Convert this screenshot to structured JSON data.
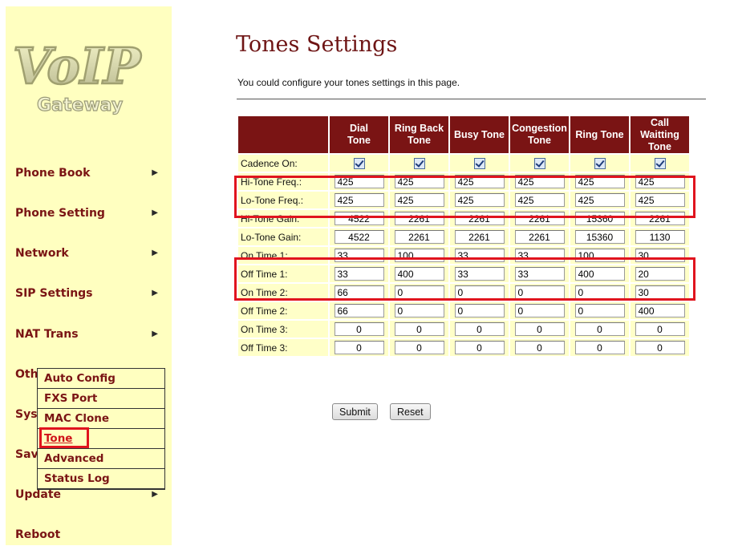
{
  "logo": {
    "text_main": "VoIP",
    "text_sub": "Gateway"
  },
  "nav": [
    {
      "label": "Phone Book",
      "arrow": "▶"
    },
    {
      "label": "Phone Setting",
      "arrow": "▶"
    },
    {
      "label": "Network",
      "arrow": "▶"
    },
    {
      "label": "SIP Settings",
      "arrow": "▶"
    },
    {
      "label": "NAT Trans",
      "arrow": "▶"
    },
    {
      "label": "Oth",
      "arrow": ""
    },
    {
      "label": "Sys",
      "arrow": ""
    },
    {
      "label": "Sav",
      "arrow": ""
    },
    {
      "label": "Update",
      "arrow": "▶"
    },
    {
      "label": "Reboot",
      "arrow": ""
    }
  ],
  "submenu": [
    {
      "label": "Auto Config"
    },
    {
      "label": "FXS Port"
    },
    {
      "label": "MAC Clone"
    },
    {
      "label": "Tone"
    },
    {
      "label": "Advanced"
    },
    {
      "label": "Status Log"
    }
  ],
  "page": {
    "title": "Tones Settings",
    "description": "You could configure your tones settings in this page."
  },
  "table": {
    "columns": [
      "Dial\nTone",
      "Ring Back\nTone",
      "Busy Tone",
      "Congestion\nTone",
      "Ring Tone",
      "Call\nWaitting\nTone"
    ],
    "checkbox_row": {
      "label": "Cadence On:",
      "checked": [
        true,
        true,
        true,
        true,
        true,
        true
      ]
    },
    "rows": [
      {
        "label": "Hi-Tone Freq.:",
        "align": "left",
        "values": [
          "425",
          "425",
          "425",
          "425",
          "425",
          "425"
        ]
      },
      {
        "label": "Lo-Tone Freq.:",
        "align": "left",
        "values": [
          "425",
          "425",
          "425",
          "425",
          "425",
          "425"
        ]
      },
      {
        "label": "Hi-Tone Gain:",
        "align": "center",
        "values": [
          "4522",
          "2261",
          "2261",
          "2261",
          "15360",
          "2261"
        ]
      },
      {
        "label": "Lo-Tone Gain:",
        "align": "center",
        "values": [
          "4522",
          "2261",
          "2261",
          "2261",
          "15360",
          "1130"
        ]
      },
      {
        "label": "On Time 1:",
        "align": "left",
        "values": [
          "33",
          "100",
          "33",
          "33",
          "100",
          "30"
        ]
      },
      {
        "label": "Off Time 1:",
        "align": "left",
        "values": [
          "33",
          "400",
          "33",
          "33",
          "400",
          "20"
        ]
      },
      {
        "label": "On Time 2:",
        "align": "left",
        "values": [
          "66",
          "0",
          "0",
          "0",
          "0",
          "30"
        ]
      },
      {
        "label": "Off Time 2:",
        "align": "left",
        "values": [
          "66",
          "0",
          "0",
          "0",
          "0",
          "400"
        ]
      },
      {
        "label": "On Time 3:",
        "align": "center",
        "values": [
          "0",
          "0",
          "0",
          "0",
          "0",
          "0"
        ]
      },
      {
        "label": "Off Time 3:",
        "align": "center",
        "values": [
          "0",
          "0",
          "0",
          "0",
          "0",
          "0"
        ]
      }
    ]
  },
  "buttons": {
    "submit": "Submit",
    "reset": "Reset"
  },
  "colors": {
    "sidebar_bg": "#ffffc0",
    "header_bg": "#7a1414",
    "cell_bg": "#ffffc8",
    "highlight": "#e0141e"
  }
}
